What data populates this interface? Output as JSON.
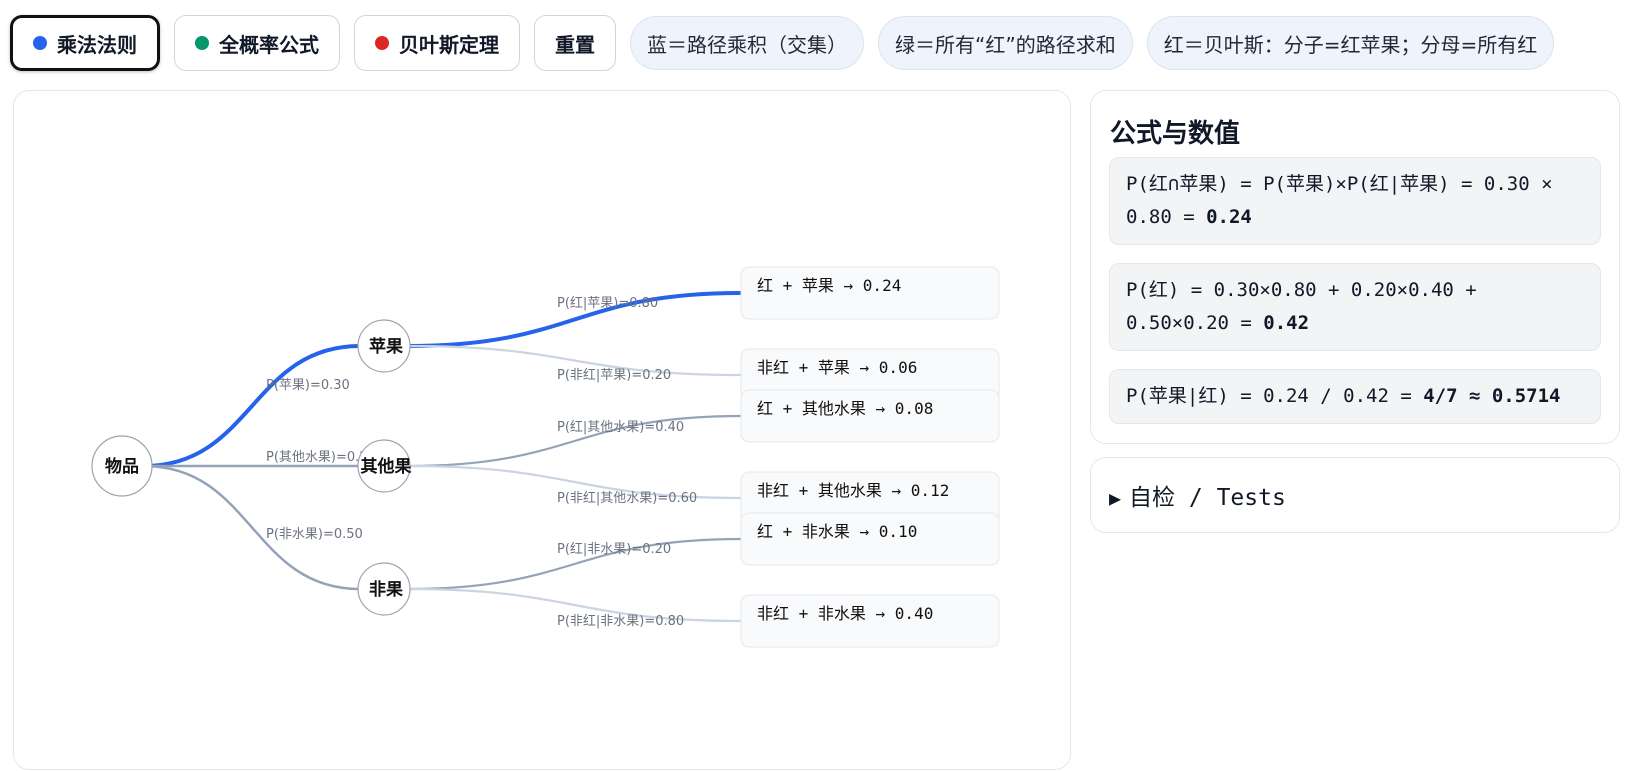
{
  "toolbar": {
    "buttons": [
      {
        "label": "乘法法则",
        "dot_color": "#2563eb"
      },
      {
        "label": "全概率公式",
        "dot_color": "#059669"
      },
      {
        "label": "贝叶斯定理",
        "dot_color": "#dc2626"
      },
      {
        "label": "重置"
      }
    ],
    "legends": [
      "蓝＝路径乘积（交集）",
      "绿＝所有“红”的路径求和",
      "红＝贝叶斯：分子=红苹果；分母=所有红"
    ]
  },
  "tree": {
    "root": "物品",
    "branches": [
      {
        "name": "苹果",
        "edge_label": "P(苹果)=0.30",
        "highlight": true,
        "leaves": [
          {
            "edge_label": "P(红|苹果)=0.80",
            "leaf": "红 + 苹果 → 0.24",
            "highlight": true
          },
          {
            "edge_label": "P(非红|苹果)=0.20",
            "leaf": "非红 + 苹果 → 0.06",
            "highlight": false
          }
        ]
      },
      {
        "name": "其他果",
        "edge_label": "P(其他水果)=0.20",
        "highlight": false,
        "leaves": [
          {
            "edge_label": "P(红|其他水果)=0.40",
            "leaf": "红 + 其他水果 → 0.08",
            "highlight": false
          },
          {
            "edge_label": "P(非红|其他水果)=0.60",
            "leaf": "非红 + 其他水果 → 0.12",
            "highlight": false
          }
        ]
      },
      {
        "name": "非果",
        "edge_label": "P(非水果)=0.50",
        "highlight": false,
        "leaves": [
          {
            "edge_label": "P(红|非水果)=0.20",
            "leaf": "红 + 非水果 → 0.10",
            "highlight": false
          },
          {
            "edge_label": "P(非红|非水果)=0.80",
            "leaf": "非红 + 非水果 → 0.40",
            "highlight": false
          }
        ]
      }
    ]
  },
  "colors": {
    "highlight": "#2563eb",
    "edge_red": "#94a3b8",
    "edge_notred": "#cbd5e1"
  },
  "formulas": {
    "title": "公式与数值",
    "f1_main": "P(红∩苹果) = P(苹果)×P(红|苹果) = 0.30 × 0.80 = ",
    "f1_result": "0.24",
    "f2_main": "P(红) = 0.30×0.80 + 0.20×0.40 + 0.50×0.20 = ",
    "f2_result": "0.42",
    "f3_main": "P(苹果|红) = 0.24 / 0.42 = ",
    "f3_result": "4/7 ≈ 0.5714"
  },
  "tests": {
    "label": "自检 / Tests"
  }
}
